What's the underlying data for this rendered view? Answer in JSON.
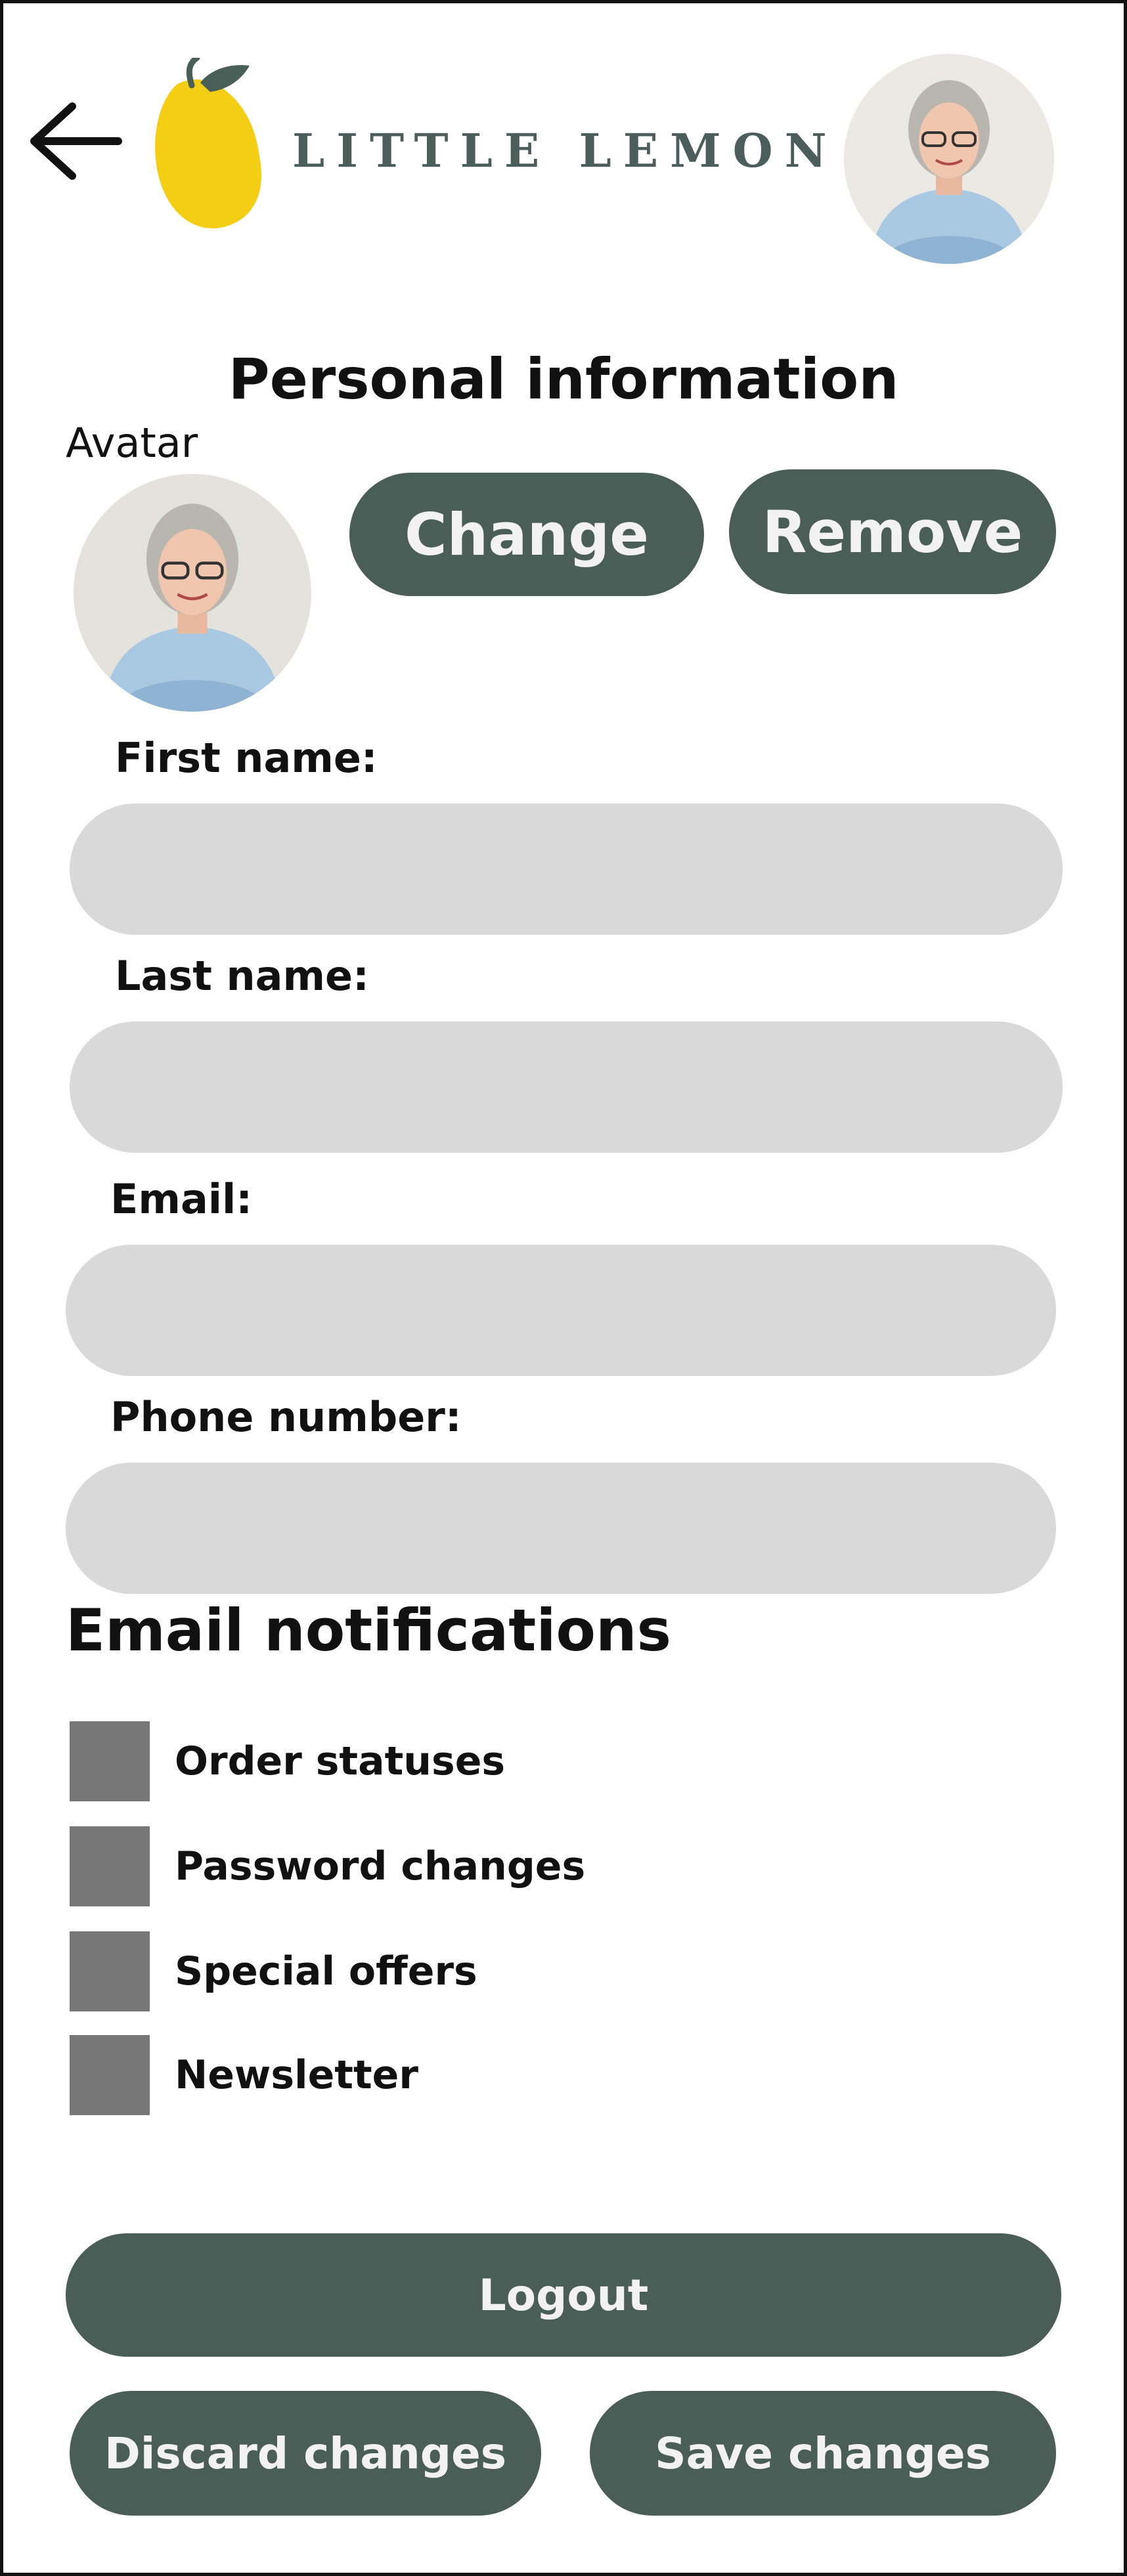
{
  "header": {
    "back_icon": "arrow-left-icon",
    "logo_text": "LITTLE LEMON",
    "logo_icon": "lemon-icon"
  },
  "profile": {
    "section_title": "Personal information",
    "avatar_label": "Avatar",
    "change_label": "Change",
    "remove_label": "Remove"
  },
  "fields": {
    "first_name": {
      "label": "First name:",
      "value": ""
    },
    "last_name": {
      "label": "Last name:",
      "value": ""
    },
    "email": {
      "label": "Email:",
      "value": ""
    },
    "phone": {
      "label": "Phone number:",
      "value": ""
    }
  },
  "notifications": {
    "title": "Email notifications",
    "items": [
      {
        "label": "Order statuses",
        "checked": false
      },
      {
        "label": "Password changes",
        "checked": false
      },
      {
        "label": "Special offers",
        "checked": false
      },
      {
        "label": "Newsletter",
        "checked": false
      }
    ]
  },
  "actions": {
    "logout_label": "Logout",
    "discard_label": "Discard changes",
    "save_label": "Save changes"
  },
  "colors": {
    "primary_button": "#4a5e57",
    "input_background": "#d9d9d9",
    "checkbox": "#777777",
    "lemon": "#f4ce14"
  }
}
